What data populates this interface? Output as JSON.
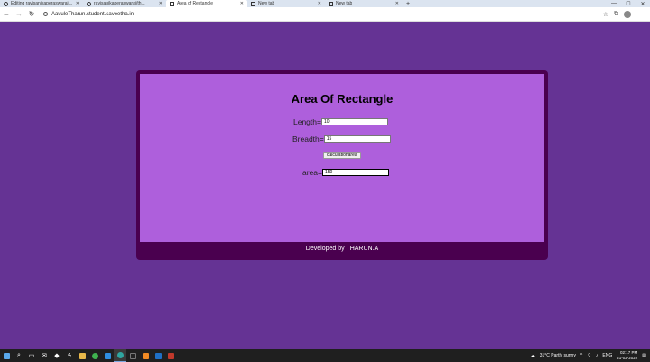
{
  "browser": {
    "tabs": [
      {
        "label": "Editing ravisanikaperaswaraj/th...",
        "active": false
      },
      {
        "label": "ravisanikaperaswaraj/th...",
        "active": false
      },
      {
        "label": "Area of Rectangle",
        "active": true
      },
      {
        "label": "New tab",
        "active": false
      },
      {
        "label": "New tab",
        "active": false
      }
    ],
    "url": "AavuleTharun.student.saveetha.in"
  },
  "page": {
    "title": "Area Of Rectangle",
    "length_label": "Length=",
    "length_value": "10",
    "breadth_label": "Breadth=",
    "breadth_value": "15",
    "button_label": "calculationarea",
    "area_label": "area=",
    "area_value": "150",
    "footer": "Developed by THARUN.A"
  },
  "colors": {
    "page_bg": "#653394",
    "card_border": "#4a004f",
    "card_bg": "#ae5fdc"
  },
  "taskbar": {
    "weather": "31°C  Partly sunny",
    "lang": "ENG",
    "time": "02:17 PM",
    "date": "21-02-2022"
  }
}
